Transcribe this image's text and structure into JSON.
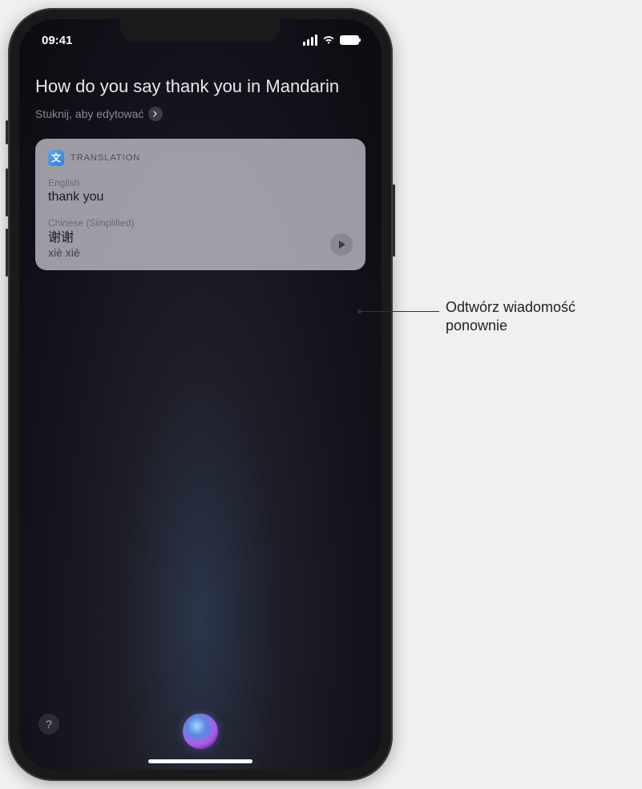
{
  "status": {
    "time": "09:41"
  },
  "siri": {
    "query": "How do you say thank you in Mandarin",
    "edit_hint": "Stuknij, aby edytować"
  },
  "card": {
    "app_name": "TRANSLATION",
    "source_lang": "English",
    "source_text": "thank you",
    "target_lang": "Chinese (Simplified)",
    "target_text": "谢谢",
    "target_romanization": "xiè xiè"
  },
  "callout": {
    "line1": "Odtwórz wiadomość",
    "line2": "ponownie"
  },
  "help_glyph": "?"
}
